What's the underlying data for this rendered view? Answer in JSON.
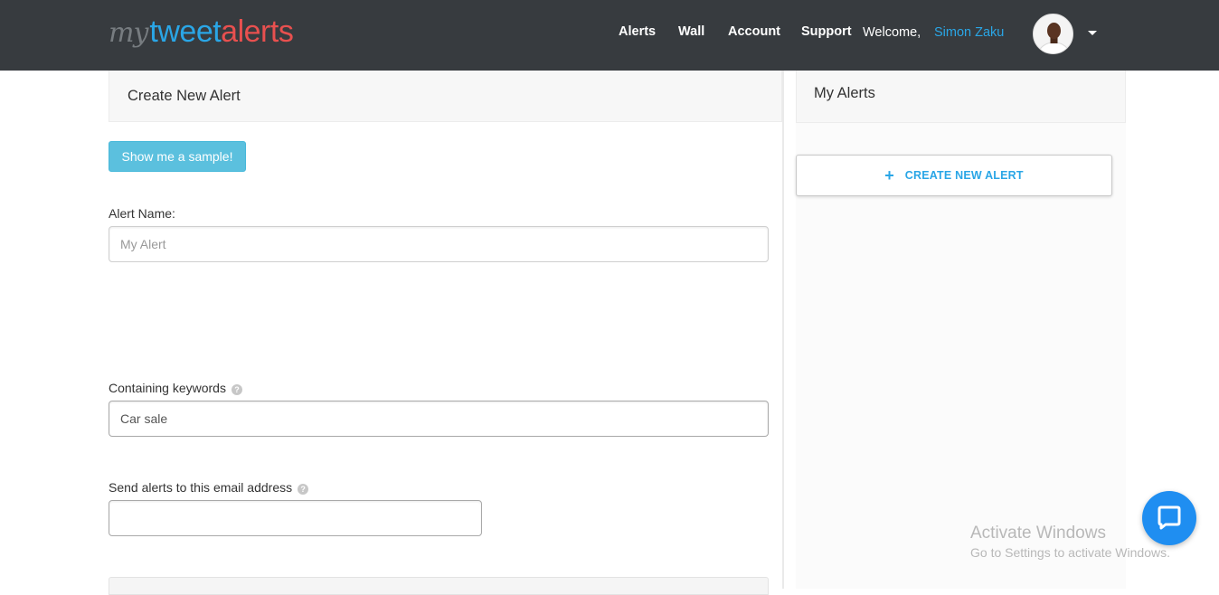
{
  "brand": {
    "my": "my",
    "tweet": "tweet",
    "alerts": "alerts"
  },
  "nav": {
    "alerts": "Alerts",
    "wall": "Wall",
    "account": "Account",
    "support": "Support"
  },
  "user": {
    "welcome": "Welcome,",
    "name": "Simon Zaku"
  },
  "create_panel": {
    "title": "Create New Alert",
    "sample_button": "Show me a sample!",
    "alert_name_label": "Alert Name:",
    "alert_name_placeholder": "My Alert",
    "keywords_label": "Containing keywords",
    "keywords_value": "Car sale",
    "email_label": "Send alerts to this email address",
    "email_value": ""
  },
  "my_alerts": {
    "title": "My Alerts",
    "create_button": "CREATE NEW ALERT"
  },
  "watermark": {
    "line1": "Activate Windows",
    "line2": "Go to Settings to activate Windows."
  },
  "colors": {
    "topbar": "#373b3f",
    "accent_blue": "#2aa6e6",
    "accent_red": "#e8504f",
    "sample_button": "#5bc0de",
    "chat": "#1f8ef1"
  },
  "icons": {
    "help": "question-circle-icon",
    "plus": "plus-icon",
    "caret": "caret-down-icon",
    "chat": "chat-bubble-icon"
  }
}
